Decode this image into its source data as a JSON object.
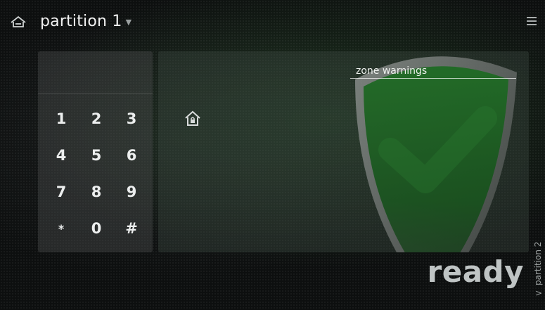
{
  "header": {
    "title": "partition 1",
    "dropdown_caret": "▼",
    "home_icon": "home-icon",
    "menu_icon": "menu-icon"
  },
  "keypad": {
    "keys": [
      "1",
      "2",
      "3",
      "4",
      "5",
      "6",
      "7",
      "8",
      "9",
      "*",
      "0",
      "#"
    ]
  },
  "status": {
    "zone_warnings_label": "zone warnings",
    "state_label": "ready",
    "state_icon": "shield-check-icon",
    "arm_icon": "home-lock-icon",
    "state_color": "#1f6b24"
  },
  "side_tab": {
    "label": "partition 2",
    "chevron": ">"
  }
}
